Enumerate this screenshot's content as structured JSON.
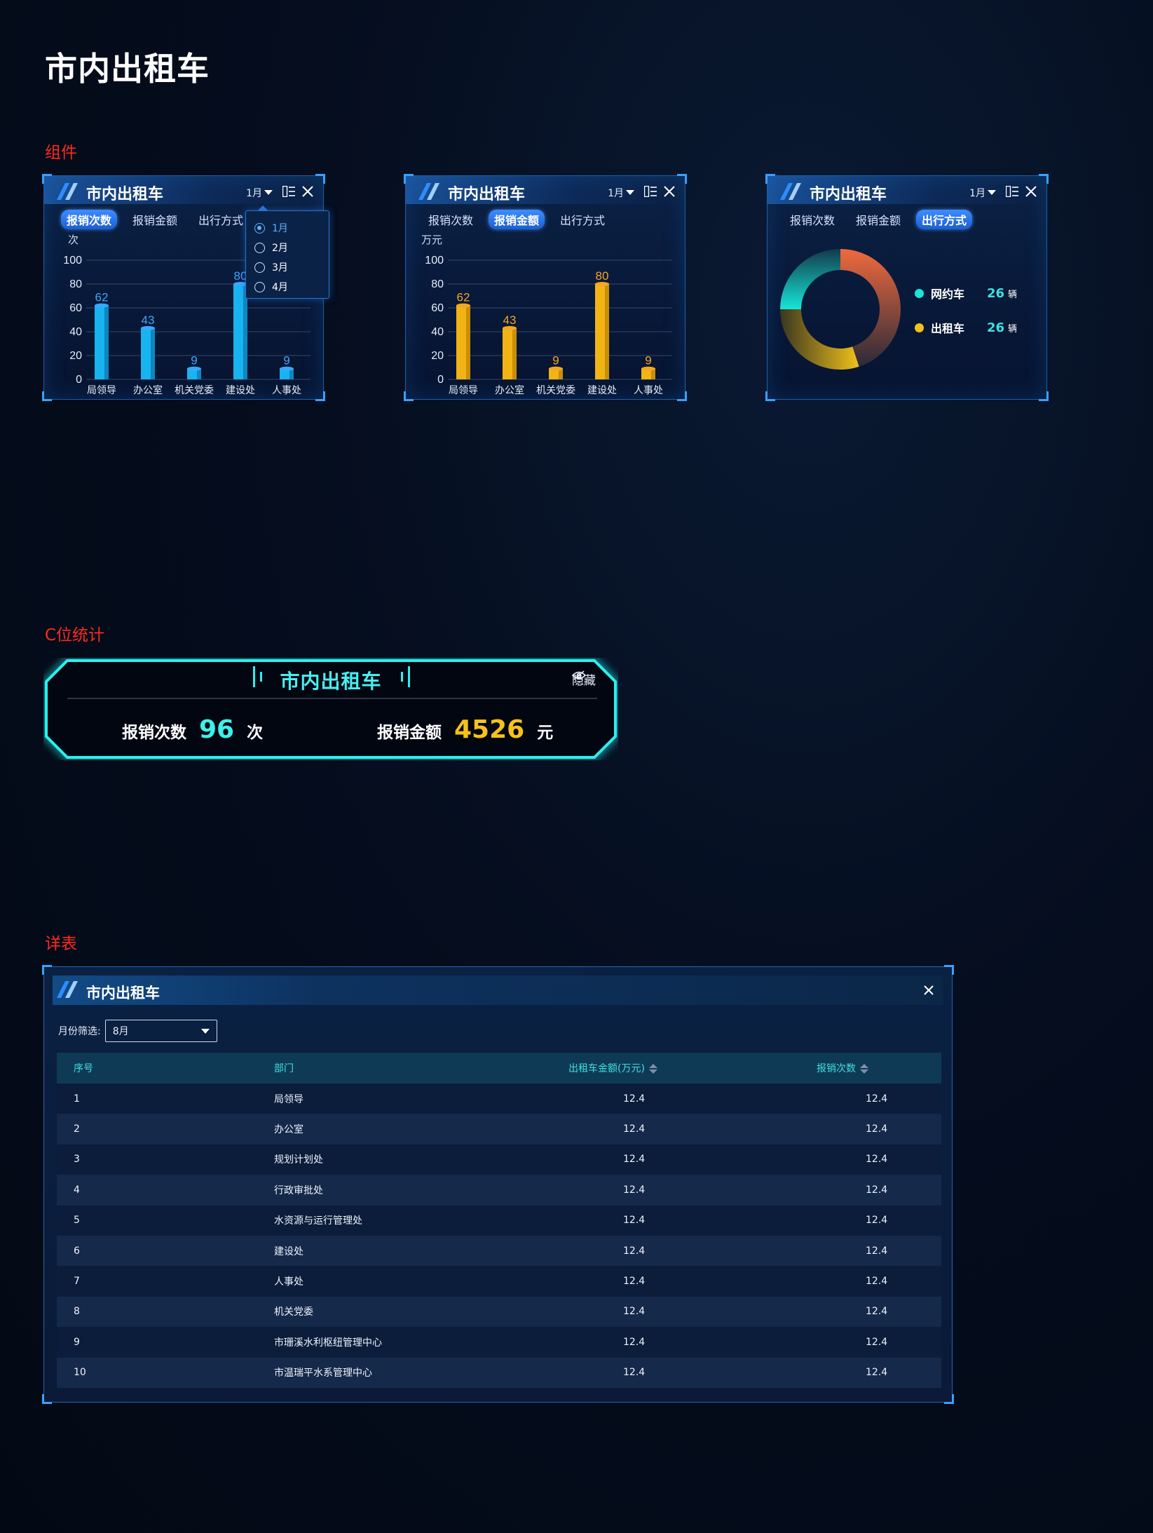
{
  "page_title": "市内出租车",
  "sections": {
    "components": "组件",
    "c_stat": "C位统计",
    "detail": "详表"
  },
  "panel_title": "市内出租车",
  "month_label": "1月",
  "tabs": [
    "报销次数",
    "报销金额",
    "出行方式"
  ],
  "dropdown_options": [
    "1月",
    "2月",
    "3月",
    "4月"
  ],
  "colors": {
    "blue_bar": "#18b4f0",
    "gold_bar": "#f2b414",
    "cyan": "#17e6d8",
    "gold": "#f1c21b",
    "orange": "#f06a3c",
    "section_red": "#ff2a1f"
  },
  "chart_data": [
    {
      "type": "bar",
      "unit_label": "次",
      "categories": [
        "局领导",
        "办公室",
        "机关党委",
        "建设处",
        "人事处"
      ],
      "values": [
        62,
        43,
        9,
        80,
        9
      ],
      "ylim": [
        0,
        100
      ],
      "yticks": [
        0,
        20,
        40,
        60,
        80,
        100
      ],
      "grid": true
    },
    {
      "type": "bar",
      "unit_label": "万元",
      "categories": [
        "局领导",
        "办公室",
        "机关党委",
        "建设处",
        "人事处"
      ],
      "values": [
        62,
        43,
        9,
        80,
        9
      ],
      "ylim": [
        0,
        100
      ],
      "yticks": [
        0,
        20,
        40,
        60,
        80,
        100
      ],
      "grid": true
    },
    {
      "type": "pie",
      "series": [
        {
          "name": "网约车",
          "value": 26,
          "unit": "辆",
          "color": "#17e6d8"
        },
        {
          "name": "出租车",
          "value": 26,
          "unit": "辆",
          "color": "#f1c21b"
        }
      ]
    }
  ],
  "c_stat": {
    "title": "市内出租车",
    "hide_label": "隐藏",
    "count_label": "报销次数",
    "count_value": "96",
    "count_unit": "次",
    "amount_label": "报销金额",
    "amount_value": "4526",
    "amount_unit": "元"
  },
  "detail": {
    "title": "市内出租车",
    "filter_label": "月份筛选:",
    "filter_value": "8月",
    "columns": [
      "序号",
      "部门",
      "出租车金额(万元)",
      "报销次数"
    ],
    "rows": [
      [
        "1",
        "局领导",
        "12.4",
        "12.4"
      ],
      [
        "2",
        "办公室",
        "12.4",
        "12.4"
      ],
      [
        "3",
        "规划计划处",
        "12.4",
        "12.4"
      ],
      [
        "4",
        "行政审批处",
        "12.4",
        "12.4"
      ],
      [
        "5",
        "水资源与运行管理处",
        "12.4",
        "12.4"
      ],
      [
        "6",
        "建设处",
        "12.4",
        "12.4"
      ],
      [
        "7",
        "人事处",
        "12.4",
        "12.4"
      ],
      [
        "8",
        "机关党委",
        "12.4",
        "12.4"
      ],
      [
        "9",
        "市珊溪水利枢纽管理中心",
        "12.4",
        "12.4"
      ],
      [
        "10",
        "市温瑞平水系管理中心",
        "12.4",
        "12.4"
      ]
    ]
  }
}
